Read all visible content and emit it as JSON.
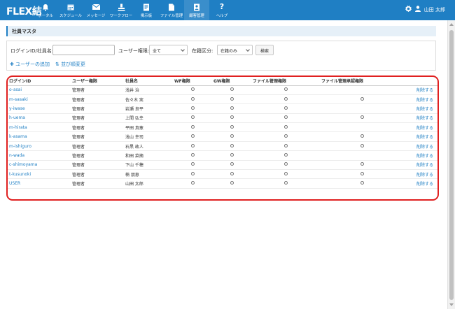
{
  "app": {
    "logo": "FLEX結"
  },
  "nav": [
    {
      "label": "ポータル",
      "icon": "bell-icon"
    },
    {
      "label": "スケジュール",
      "icon": "calendar-icon"
    },
    {
      "label": "メッセージ",
      "icon": "mail-icon"
    },
    {
      "label": "ワークフロー",
      "icon": "workflow-icon"
    },
    {
      "label": "掲示板",
      "icon": "board-icon"
    },
    {
      "label": "ファイル管理",
      "icon": "file-icon"
    },
    {
      "label": "顧客管理",
      "icon": "customer-icon"
    },
    {
      "label": "ヘルプ",
      "icon": "help-icon"
    }
  ],
  "user": {
    "name": "山田 太郎"
  },
  "page": {
    "title": "社員マスタ"
  },
  "filter": {
    "id_label": "ログインID/社員名:",
    "id_value": "",
    "usertype_label": "ユーザー権限:",
    "usertype_value": "全て",
    "status_label": "在籍区分:",
    "status_value": "在籍のみ",
    "search_label": "検索",
    "add_user_label": "ユーザーの追加",
    "sort_label": "並び順変更"
  },
  "table": {
    "headers": [
      "ログインID",
      "ユーザー権限",
      "社員名",
      "WF権限",
      "GW権限",
      "ファイル管理権限",
      "ファイル管理承認権限",
      ""
    ],
    "delete_label": "削除する",
    "rows": [
      {
        "id": "o-asai",
        "role": "管理者",
        "name": "浅井 治",
        "wf": true,
        "gw": true,
        "file": true,
        "approve": false
      },
      {
        "id": "m-sasaki",
        "role": "管理者",
        "name": "佐々木 実",
        "wf": true,
        "gw": true,
        "file": true,
        "approve": true
      },
      {
        "id": "y-iwase",
        "role": "管理者",
        "name": "岩瀬 良平",
        "wf": true,
        "gw": true,
        "file": true,
        "approve": false
      },
      {
        "id": "h-uema",
        "role": "管理者",
        "name": "上間 弘幸",
        "wf": true,
        "gw": true,
        "file": true,
        "approve": true
      },
      {
        "id": "m-hirata",
        "role": "管理者",
        "name": "平田 真憲",
        "wf": true,
        "gw": true,
        "file": true,
        "approve": false
      },
      {
        "id": "k-asama",
        "role": "管理者",
        "name": "浅山 幸司",
        "wf": true,
        "gw": true,
        "file": true,
        "approve": true
      },
      {
        "id": "m-ishiguro",
        "role": "管理者",
        "name": "石黒 政人",
        "wf": true,
        "gw": true,
        "file": true,
        "approve": true
      },
      {
        "id": "n-wada",
        "role": "管理者",
        "name": "和田 菜摘",
        "wf": true,
        "gw": true,
        "file": true,
        "approve": false
      },
      {
        "id": "c-shimoyama",
        "role": "管理者",
        "name": "下山 千穂",
        "wf": true,
        "gw": true,
        "file": true,
        "approve": true
      },
      {
        "id": "t-kusunoki",
        "role": "管理者",
        "name": "楠 朋恵",
        "wf": true,
        "gw": true,
        "file": true,
        "approve": true
      },
      {
        "id": "USER",
        "role": "管理者",
        "name": "山田 太郎",
        "wf": true,
        "gw": true,
        "file": true,
        "approve": true
      }
    ]
  },
  "colors": {
    "accent": "#1f7fc4",
    "highlight": "#e02020"
  }
}
